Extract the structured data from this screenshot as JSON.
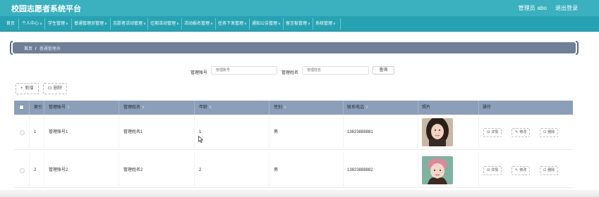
{
  "header": {
    "title": "校园志愿者系统平台",
    "user_role": "管理员",
    "username": "abo",
    "logout_label": "退出登录"
  },
  "nav": {
    "items": [
      {
        "label": "首页",
        "has_menu": false
      },
      {
        "label": "个人中心",
        "has_menu": true
      },
      {
        "label": "学生管理",
        "has_menu": true
      },
      {
        "label": "普通管理员管理",
        "has_menu": true
      },
      {
        "label": "志愿者活动管理",
        "has_menu": true
      },
      {
        "label": "往期活动管理",
        "has_menu": true
      },
      {
        "label": "活动报名管理",
        "has_menu": true
      },
      {
        "label": "任务下发管理",
        "has_menu": true
      },
      {
        "label": "通知公告管理",
        "has_menu": true
      },
      {
        "label": "留言板管理",
        "has_menu": true
      },
      {
        "label": "系统管理",
        "has_menu": true
      }
    ]
  },
  "breadcrumb": {
    "home": "首页",
    "separator": "/",
    "current": "普通管理员"
  },
  "search": {
    "account_label": "管理账号",
    "account_placeholder": "管理账号",
    "name_label": "管理姓名",
    "name_placeholder": "管理姓名",
    "button_label": "查询"
  },
  "toolbar": {
    "add_label": "新增",
    "delete_label": "删除"
  },
  "table": {
    "headers": {
      "index": "索引",
      "account": "管理账号",
      "name": "管理姓名",
      "age": "年龄",
      "gender": "性别",
      "phone": "联系电话",
      "photo": "照片",
      "actions": "操作"
    },
    "rows": [
      {
        "index": "1",
        "account": "管理账号1",
        "name": "管理姓名1",
        "age": "1",
        "gender": "男",
        "phone": "13823888881"
      },
      {
        "index": "2",
        "account": "管理账号2",
        "name": "管理姓名2",
        "age": "2",
        "gender": "男",
        "phone": "13823888882"
      }
    ],
    "row_actions": {
      "detail": "详情",
      "edit": "修改",
      "delete": "删除"
    }
  },
  "colors": {
    "topbar": "#3bb0be",
    "navbar": "#27a2b3",
    "breadcrumb": "#6e7f96",
    "table_header": "#8c9fb8"
  }
}
